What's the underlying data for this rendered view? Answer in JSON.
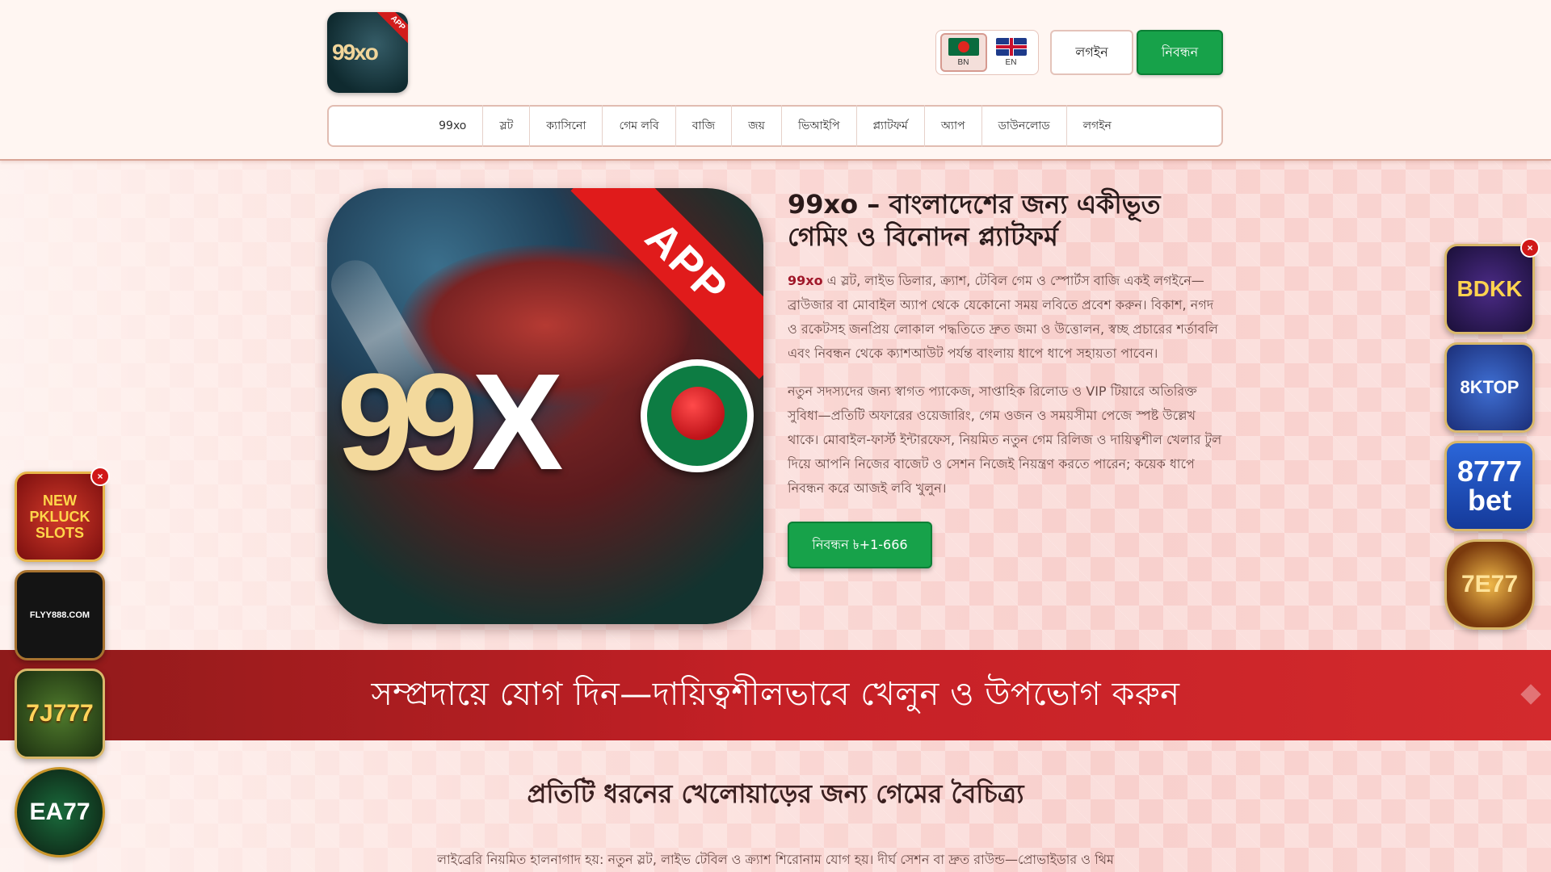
{
  "header": {
    "logo_label": "99xo",
    "logo_ribbon": "APP",
    "languages": [
      {
        "code": "BN",
        "active": true
      },
      {
        "code": "EN",
        "active": false
      }
    ],
    "login_label": "লগইন",
    "register_label": "নিবন্ধন"
  },
  "nav": {
    "items": [
      "99xo",
      "স্লট",
      "ক্যাসিনো",
      "গেম লবি",
      "বাজি",
      "জয়",
      "ভিআইপি",
      "প্ল্যাটফর্ম",
      "অ্যাপ",
      "ডাউনলোড",
      "লগইন"
    ]
  },
  "hero": {
    "image_ribbon": "APP",
    "image_brand_a": "99",
    "image_brand_b": "X",
    "title": "99xo – বাংলাদেশের জন্য একীভূত গেমিং ও বিনোদন প্ল্যাটফর্ম",
    "para1_brand": "99xo",
    "para1_text": " এ স্লট, লাইভ ডিলার, ক্র্যাশ, টেবিল গেম ও স্পোর্টস বাজি একই লগইনে—ব্রাউজার বা মোবাইল অ্যাপ থেকে যেকোনো সময় লবিতে প্রবেশ করুন। বিকাশ, নগদ ও রকেটসহ জনপ্রিয় লোকাল পদ্ধতিতে দ্রুত জমা ও উত্তোলন, স্বচ্ছ প্রচারের শর্তাবলি এবং নিবন্ধন থেকে ক্যাশআউট পর্যন্ত বাংলায় ধাপে ধাপে সহায়তা পাবেন।",
    "para2": "নতুন সদস্যদের জন্য স্বাগত প্যাকেজ, সাপ্তাহিক রিলোড ও VIP টিয়ারে অতিরিক্ত সুবিধা—প্রতিটি অফারের ওয়েজারিং, গেম ওজন ও সময়সীমা পেজে স্পষ্ট উল্লেখ থাকে। মোবাইল-ফার্স্ট ইন্টারফেস, নিয়মিত নতুন গেম রিলিজ ও দায়িত্বশীল খেলার টুল দিয়ে আপনি নিজের বাজেট ও সেশন নিজেই নিয়ন্ত্রণ করতে পারেন; কয়েক ধাপে নিবন্ধন করে আজই লবি খুলুন।",
    "cta": "নিবন্ধন ৳+1-666"
  },
  "banner": {
    "text": "সম্প্রদায়ে যোগ দিন—দায়িত্বশীলভাবে খেলুন ও উপভোগ করুন"
  },
  "section": {
    "title": "প্রতিটি ধরনের খেলোয়াড়ের জন্য গেমের বৈচিত্র্য",
    "para": "লাইব্রেরি নিয়মিত হালনাগাদ হয়: নতুন স্লট, লাইভ টেবিল ও ক্র্যাশ শিরোনাম যোগ হয়। দীর্ঘ সেশন বা দ্রুত রাউন্ড—প্রোভাইডার ও থিম"
  },
  "side_ads": {
    "close": "×",
    "left": [
      "NEW PKLUCK SLOTS",
      "FLYY888.COM",
      "7J777",
      "EA77"
    ],
    "right": [
      "BDKK",
      "8KTOP",
      "8777 bet",
      "7E77"
    ]
  },
  "colors": {
    "brand_green": "#17a24a",
    "banner_red": "#c52026",
    "accent_red": "#a0182a"
  }
}
